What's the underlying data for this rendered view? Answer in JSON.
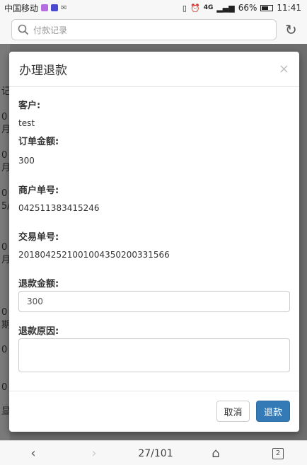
{
  "status_bar": {
    "carrier": "中国移动",
    "network": "4G",
    "battery": "66%",
    "battery_level": 0.66,
    "time": "11:41"
  },
  "browser": {
    "search_placeholder": "付款记录"
  },
  "behind_page": {
    "fragments": [
      "记",
      "0",
      "月",
      "0",
      "月",
      "0",
      "0",
      "5/",
      "0",
      "月",
      "0",
      "期",
      "0",
      "0",
      "显"
    ]
  },
  "modal": {
    "title": "办理退款",
    "close": "×",
    "customer_label": "客户:",
    "customer_value": "test",
    "order_amount_label": "订单金额:",
    "order_amount_value": "300",
    "merchant_no_label": "商户单号:",
    "merchant_no_value": "042511383415246",
    "trade_no_label": "交易单号:",
    "trade_no_value": "20180425210010043502003315​66",
    "refund_amount_label": "退款金额:",
    "refund_amount_value": "300",
    "refund_reason_label": "退款原因:",
    "refund_reason_value": "",
    "cancel_label": "取消",
    "refund_label": "退款"
  },
  "bottom_nav": {
    "page_indicator": "27/101",
    "tab_count": "2"
  }
}
